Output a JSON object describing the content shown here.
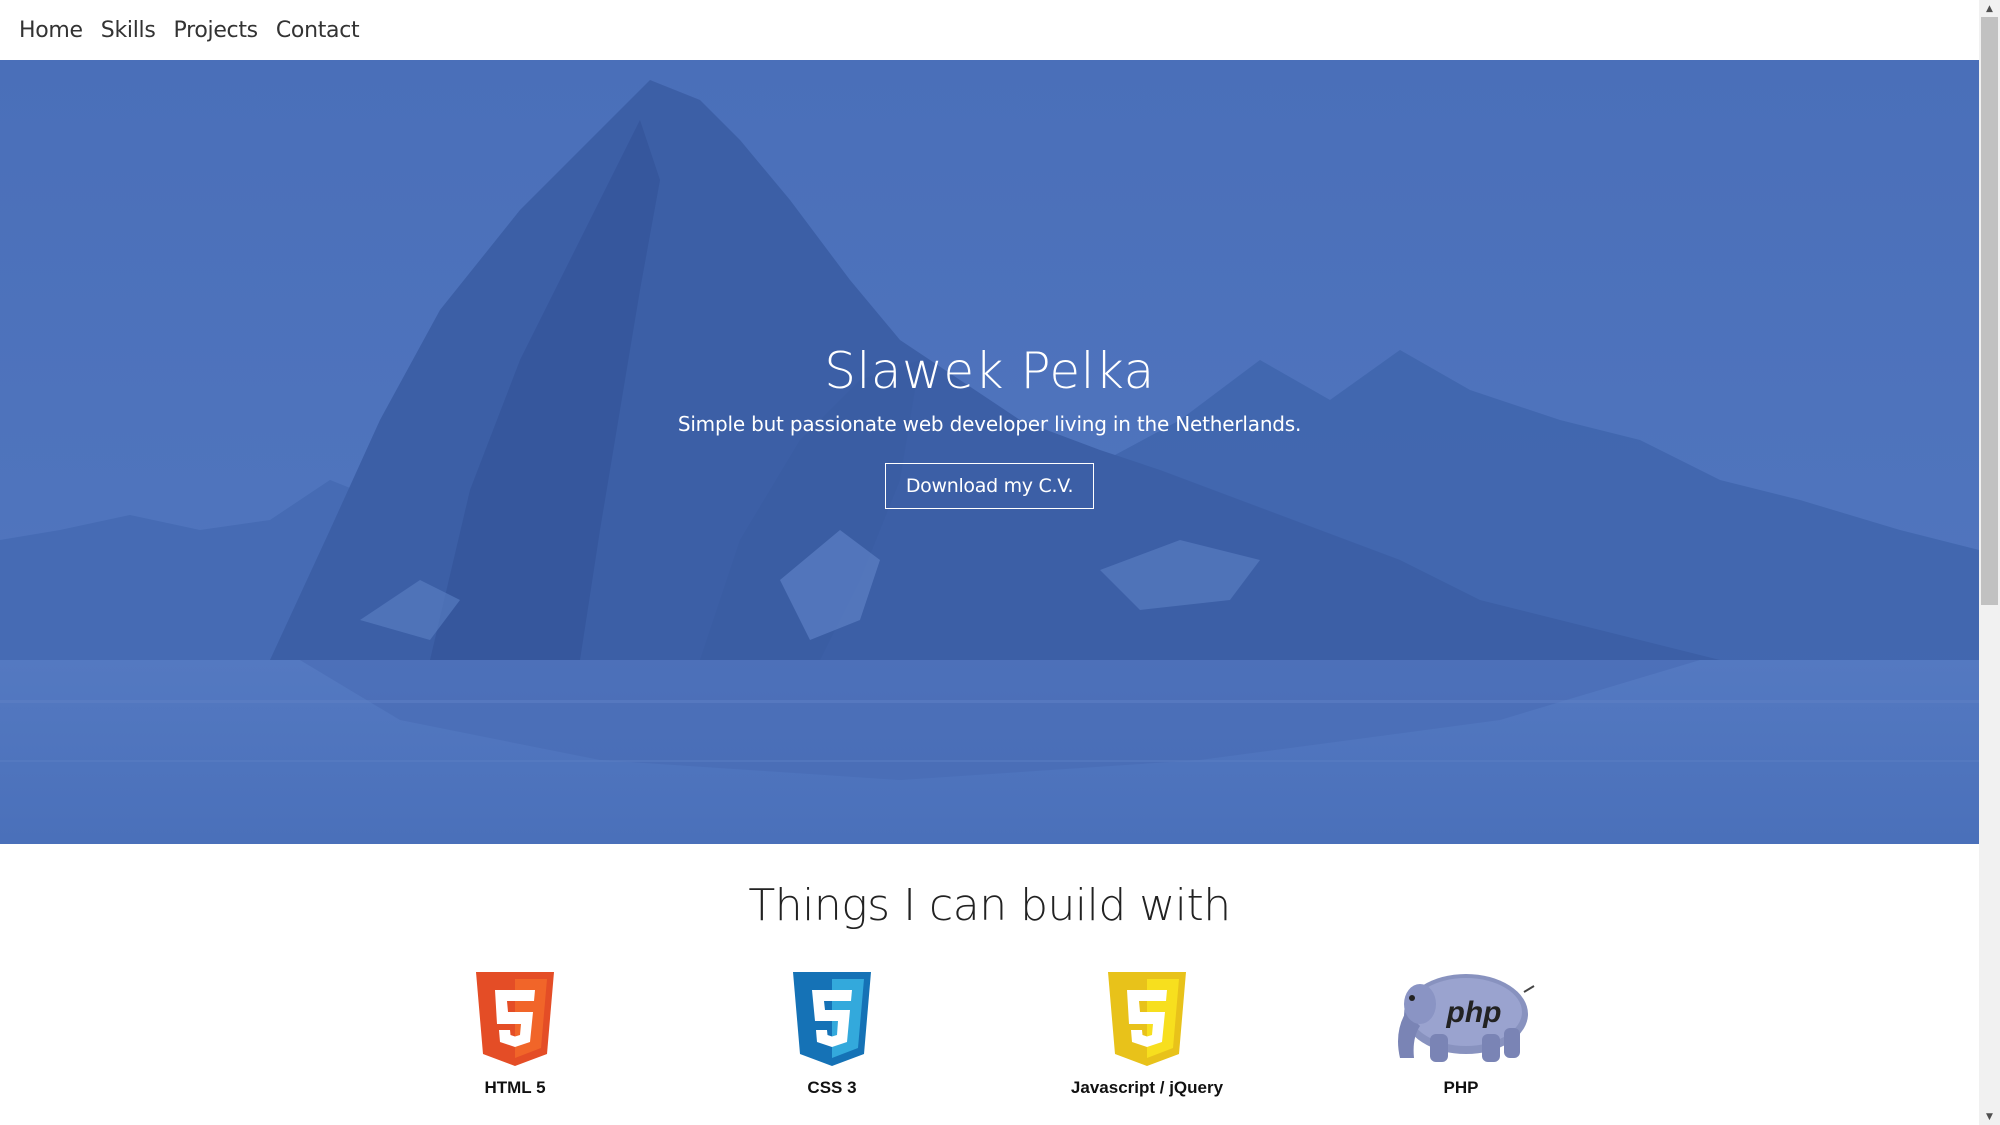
{
  "nav": {
    "items": [
      {
        "label": "Home"
      },
      {
        "label": "Skills"
      },
      {
        "label": "Projects"
      },
      {
        "label": "Contact"
      }
    ]
  },
  "hero": {
    "title": "Slawek Pelka",
    "subtitle": "Simple but passionate web developer living in the Netherlands.",
    "button_label": "Download my C.V.",
    "overlay_color": "#4a71bb"
  },
  "skills": {
    "heading": "Things I can build with",
    "items": [
      {
        "label": "HTML 5",
        "icon": "html5-logo-icon",
        "color": "#e44d26"
      },
      {
        "label": "CSS 3",
        "icon": "css3-logo-icon",
        "color": "#1572b6"
      },
      {
        "label": "Javascript / jQuery",
        "icon": "js-logo-icon",
        "color": "#f0d11c"
      },
      {
        "label": "PHP",
        "icon": "php-elephant-icon",
        "color": "#7a86b8"
      }
    ]
  },
  "scrollbar": {
    "up_glyph": "▲",
    "down_glyph": "▼"
  }
}
